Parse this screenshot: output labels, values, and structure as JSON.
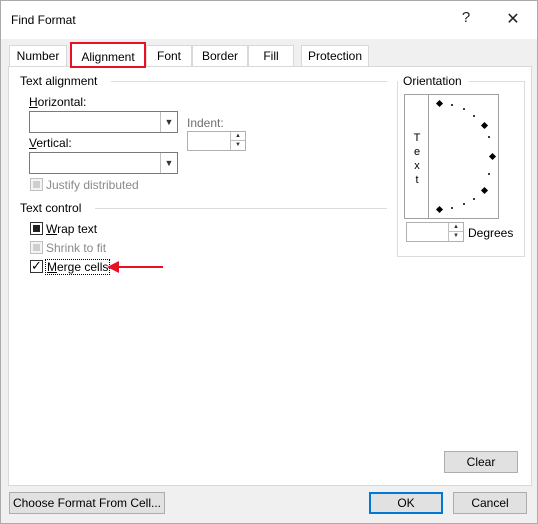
{
  "window": {
    "title": "Find Format",
    "help": "?",
    "close": "✕"
  },
  "tabs": [
    "Number",
    "Alignment",
    "Font",
    "Border",
    "Fill",
    "Protection"
  ],
  "text_alignment": {
    "section": "Text alignment",
    "horizontal": {
      "label_u": "H",
      "label_rest": "orizontal:",
      "value": ""
    },
    "vertical": {
      "label_u": "V",
      "label_rest": "ertical:",
      "value": ""
    },
    "indent": {
      "label": "Indent:",
      "value": ""
    },
    "justify_distributed": "Justify distributed"
  },
  "text_control": {
    "section": "Text control",
    "wrap_text": {
      "label_u": "W",
      "label_rest": "rap text",
      "state": "indeterminate"
    },
    "shrink_to_fit": {
      "label": "Shrink to fit",
      "state": "disabled"
    },
    "merge_cells": {
      "label_u": "M",
      "label_rest": "erge cells",
      "checked": true
    }
  },
  "orientation": {
    "section": "Orientation",
    "vertical_text": [
      "T",
      "e",
      "x",
      "t"
    ],
    "degrees_label": "Degrees",
    "degrees_value": ""
  },
  "buttons": {
    "clear": "Clear",
    "choose_format": "Choose Format From Cell...",
    "ok": "OK",
    "cancel": "Cancel"
  },
  "colors": {
    "annotation_red": "#e81123",
    "primary_border": "#0078d7"
  }
}
